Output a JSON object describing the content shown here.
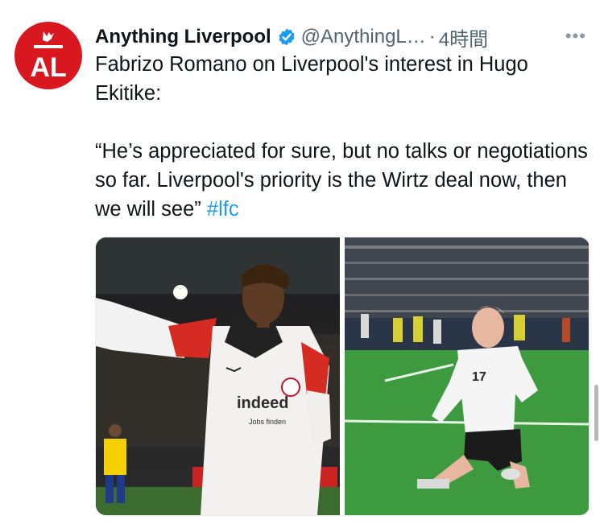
{
  "author": {
    "name": "Anything Liverpool",
    "handle": "@AnythingL…",
    "separator": "·",
    "time": "4時間",
    "more": "•••",
    "avatar_text": "AL",
    "brand_color": "#d9171f"
  },
  "tweet": {
    "line1": "Fabrizo Romano on Liverpool's interest in Hugo Ekitike:",
    "quote": "“He’s appreciated for sure, but no talks or negotiations so far. Liverpool's priority is the Wirtz deal now, then we will see”",
    "hashtag": "#lfc",
    "hashtag_color": "#1d9bf0"
  },
  "media": {
    "left_shirt_sponsor": "indeed",
    "left_shirt_subtext": "Jobs finden",
    "right_shirt_number": "17"
  }
}
